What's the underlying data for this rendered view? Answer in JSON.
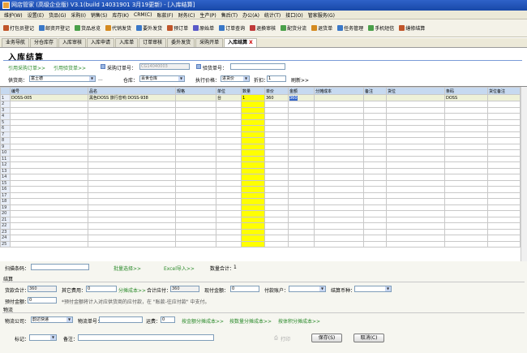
{
  "window": {
    "title": "网店管家 (高级企业版) V3.1(build 14031901 3月19更新) - [入库结算]"
  },
  "menu": [
    "维护(W)",
    "设置(E)",
    "货品(G)",
    "采购(I)",
    "销售(S)",
    "库存(K)",
    "CRM(C)",
    "账款(F)",
    "财务(C)",
    "生产(P)",
    "售后(T)",
    "办公(A)",
    "统计(T)",
    "接口(O)",
    "管家服务(G)"
  ],
  "toolbar": [
    "打包员登记",
    "邮资开登记",
    "货品总览",
    "代销发货",
    "要外发货",
    "预订单",
    "原始单",
    "订单查询",
    "退换审核",
    "配货分流",
    "退货单",
    "任务管理",
    "手机短信",
    "缮修结算"
  ],
  "tabs": [
    {
      "label": "业务导航",
      "active": false
    },
    {
      "label": "分仓库存",
      "active": false
    },
    {
      "label": "入库审核",
      "active": false
    },
    {
      "label": "入库申请",
      "active": false
    },
    {
      "label": "入库单",
      "active": false
    },
    {
      "label": "订单审核",
      "active": false
    },
    {
      "label": "委外发货",
      "active": false
    },
    {
      "label": "采购开单",
      "active": false
    },
    {
      "label": "入库结算",
      "active": true
    }
  ],
  "tab_close": "X",
  "page": {
    "title": "入库结算"
  },
  "links": {
    "ref_po": "引用采购订单>>",
    "ref_receipt": "引用验货单>>"
  },
  "form": {
    "po_label": "采购订单号：",
    "po_value": "CG14040003",
    "receipt_label": "验货单号：",
    "receipt_value": "",
    "supplier_label": "供货商：",
    "supplier_value": "富士德",
    "ellipsis": "...",
    "warehouse_label": "仓库：",
    "warehouse_value": "百世仓库",
    "price_label": "执行价格：",
    "price_value": "进货价",
    "discount_label": "折扣：",
    "discount_value": "1",
    "refresh": "刷新>>"
  },
  "grid": {
    "columns": [
      "编号",
      "品名",
      "规格",
      "单位",
      "数量",
      "单价",
      "金额",
      "分摊成本",
      "备注",
      "货位",
      "条码",
      "货位备注"
    ],
    "rows": [
      {
        "n": "1",
        "cells": [
          "DOSS-005",
          "黑色DOSS 旅行音响 DOSS-938",
          "",
          "台",
          "1",
          "360",
          "360",
          "",
          "",
          "",
          "DOSS",
          ""
        ]
      }
    ],
    "row_numbers": [
      "2",
      "3",
      "4",
      "5",
      "6",
      "7",
      "8",
      "9",
      "10",
      "11",
      "12",
      "13",
      "14",
      "15",
      "16",
      "17",
      "18",
      "19",
      "20",
      "21",
      "22",
      "23",
      "24",
      "25"
    ]
  },
  "scan": {
    "label": "扫描条码：",
    "value": "",
    "batch_select": "批量选择>>",
    "excel_import": "Excel导入>>",
    "qty_total_label": "数量合计：",
    "qty_total": "1"
  },
  "settle": {
    "section": "结算",
    "goods_total_label": "货款合计：",
    "goods_total": "360",
    "other_fee_label": "其它费用：",
    "other_fee": "0",
    "allocate_cost": "分摊成本>>",
    "payable_label": "合计应付：",
    "payable": "360",
    "current_pay_label": "现付金额：",
    "current_pay": "0",
    "pay_account_label": "付款账户：",
    "pay_account": "",
    "settle_currency_label": "结算币种：",
    "settle_currency": "",
    "pre_amount_label": "预付金额：",
    "pre_amount": "0",
    "note": "*预付金额将计入对应供货商的应付款，在 \"账款-往应付款\" 中支付。"
  },
  "logistics": {
    "section": "物流",
    "company_label": "物流公司：",
    "company": "韵达快递",
    "tracking_label": "物流单号：",
    "tracking": "",
    "freight_label": "运费：",
    "freight": "0",
    "by_amount": "按金额分摊成本>>",
    "by_qty": "按数量分摊成本>>",
    "by_volume": "按体积分摊成本>>"
  },
  "footer": {
    "tag_label": "标记：",
    "tag": "",
    "remark_label": "备注：",
    "remark": "",
    "print": "打印",
    "save": "保存(S)",
    "cancel": "取消(C)"
  },
  "colors": {
    "title_bar": "#2f62c8",
    "link_green": "#2a8a2a",
    "qty_column": "#ffff00",
    "grid_header": "#c6d9f0"
  }
}
